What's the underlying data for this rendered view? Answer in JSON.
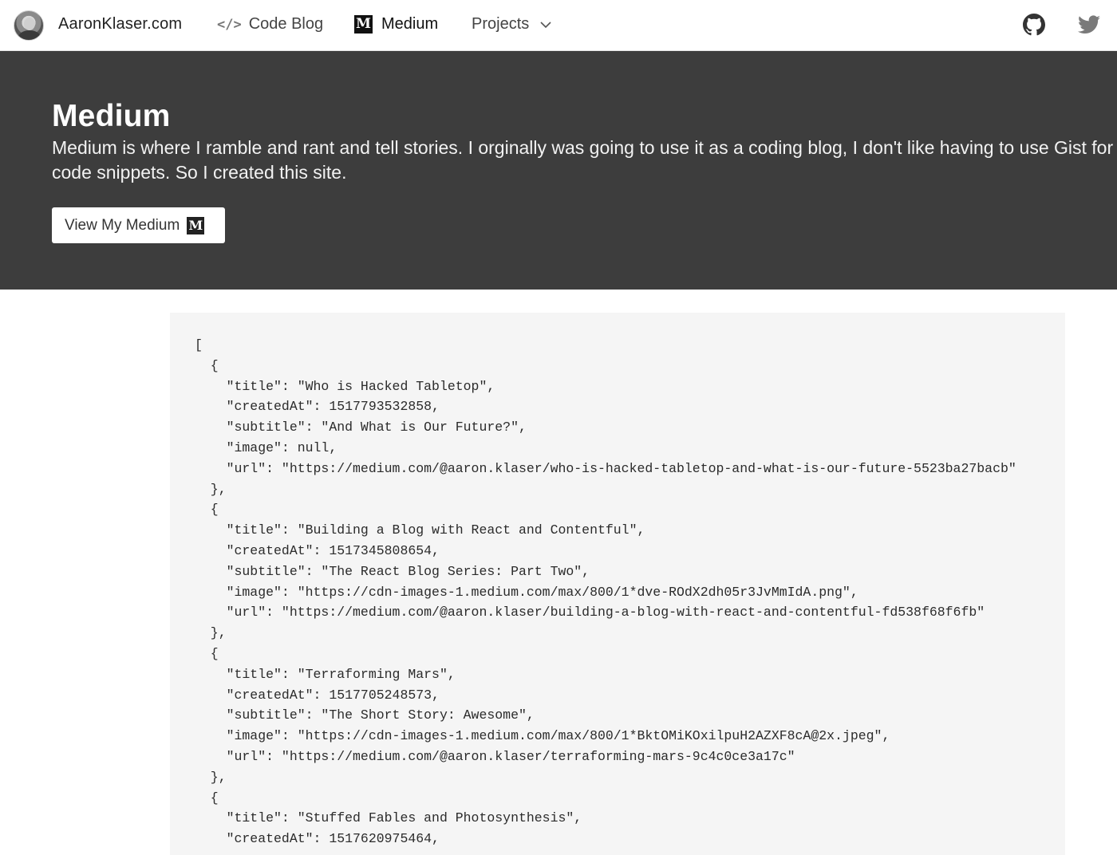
{
  "nav": {
    "brand": "AaronKlaser.com",
    "code_blog": "Code Blog",
    "code_icon_glyph": "</>",
    "medium": "Medium",
    "medium_icon_glyph": "M",
    "projects": "Projects"
  },
  "hero": {
    "title": "Medium",
    "description": "Medium is where I ramble and rant and tell stories. I orginally was going to use it as a coding blog, I don't like having to use Gist for my code snippets. So I created this site.",
    "button_label": "View My Medium",
    "button_icon_glyph": "M"
  },
  "code": {
    "content": "[\n  {\n    \"title\": \"Who is Hacked Tabletop\",\n    \"createdAt\": 1517793532858,\n    \"subtitle\": \"And What is Our Future?\",\n    \"image\": null,\n    \"url\": \"https://medium.com/@aaron.klaser/who-is-hacked-tabletop-and-what-is-our-future-5523ba27bacb\"\n  },\n  {\n    \"title\": \"Building a Blog with React and Contentful\",\n    \"createdAt\": 1517345808654,\n    \"subtitle\": \"The React Blog Series: Part Two\",\n    \"image\": \"https://cdn-images-1.medium.com/max/800/1*dve-ROdX2dh05r3JvMmIdA.png\",\n    \"url\": \"https://medium.com/@aaron.klaser/building-a-blog-with-react-and-contentful-fd538f68f6fb\"\n  },\n  {\n    \"title\": \"Terraforming Mars\",\n    \"createdAt\": 1517705248573,\n    \"subtitle\": \"The Short Story: Awesome\",\n    \"image\": \"https://cdn-images-1.medium.com/max/800/1*BktOMiKOxilpuH2AZXF8cA@2x.jpeg\",\n    \"url\": \"https://medium.com/@aaron.klaser/terraforming-mars-9c4c0ce3a17c\"\n  },\n  {\n    \"title\": \"Stuffed Fables and Photosynthesis\",\n    \"createdAt\": 1517620975464,"
  },
  "colors": {
    "hero_bg": "#3d3d3d",
    "code_bg": "#f5f5f5",
    "nav_bg": "#ffffff"
  }
}
